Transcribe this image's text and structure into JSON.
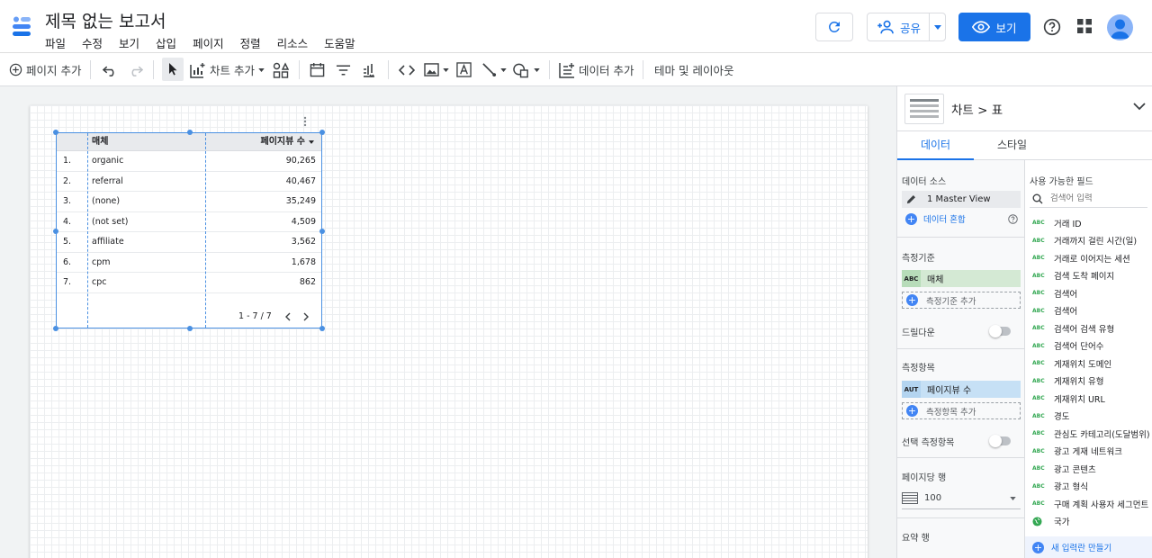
{
  "app": {
    "title": "제목 없는 보고서",
    "menu": [
      "파일",
      "수정",
      "보기",
      "삽입",
      "페이지",
      "정렬",
      "리소스",
      "도움말"
    ],
    "share_label": "공유",
    "view_label": "보기",
    "brand_color": "#1a73e8"
  },
  "toolbar": {
    "add_page": "페이지 추가",
    "add_chart": "차트 추가",
    "add_data": "데이터 추가",
    "theme_layout": "테마 및 레이아웃"
  },
  "table": {
    "headers": {
      "dimension": "매체",
      "metric": "페이지뷰 수"
    },
    "rows": [
      {
        "index": "1.",
        "medium": "organic",
        "pageviews": "90,265"
      },
      {
        "index": "2.",
        "medium": "referral",
        "pageviews": "40,467"
      },
      {
        "index": "3.",
        "medium": "(none)",
        "pageviews": "35,249"
      },
      {
        "index": "4.",
        "medium": "(not set)",
        "pageviews": "4,509"
      },
      {
        "index": "5.",
        "medium": "affiliate",
        "pageviews": "3,562"
      },
      {
        "index": "6.",
        "medium": "cpm",
        "pageviews": "1,678"
      },
      {
        "index": "7.",
        "medium": "cpc",
        "pageviews": "862"
      }
    ],
    "pagination": "1 - 7 / 7"
  },
  "panel": {
    "chart_type": "차트 > 표",
    "tabs": {
      "data": "데이터",
      "style": "스타일"
    },
    "data_source_label": "데이터 소스",
    "data_source": "1 Master View",
    "blend_label": "데이터 혼합",
    "dimension_label": "측정기준",
    "dimension_tag": "ABC",
    "dimension": "매체",
    "add_dimension": "측정기준 추가",
    "drilldown": "드릴다운",
    "metric_label": "측정항목",
    "metric_tag": "AUT",
    "metric": "페이지뷰 수",
    "add_metric": "측정항목 추가",
    "optional_metric": "선택 측정항목",
    "rows_per_page_label": "페이지당 행",
    "rows_per_page": "100",
    "summary_row": "요약 행",
    "available_fields_label": "사용 가능한 필드",
    "search_placeholder": "검색어 입력",
    "field_type": "ABC",
    "fields": [
      "거래 ID",
      "거래까지 걸린 시간(일)",
      "거래로 이어지는 세션",
      "검색 도착 페이지",
      "검색어",
      "검색어",
      "검색어 검색 유형",
      "검색어 단어수",
      "게재위치 도메인",
      "게재위치 유형",
      "게재위치 URL",
      "경도",
      "관심도 카테고리(도달범위)",
      "광고 게재 네트워크",
      "광고 콘텐츠",
      "광고 형식",
      "구매 계획 사용자 세그먼트",
      "국가"
    ],
    "new_field": "새 입력란 만들기"
  }
}
